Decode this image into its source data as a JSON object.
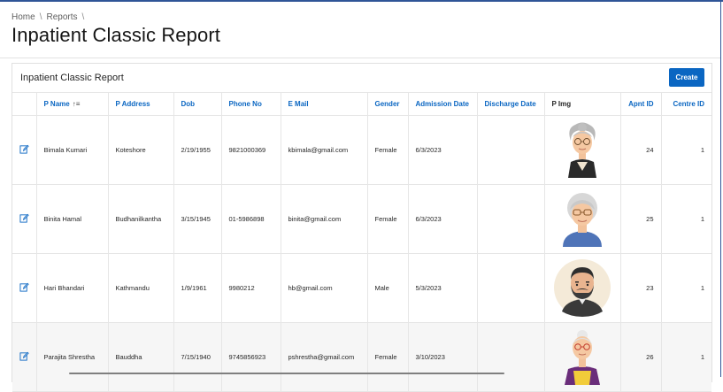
{
  "breadcrumb": {
    "items": [
      "Home",
      "Reports"
    ],
    "separator": "\\"
  },
  "page": {
    "title": "Inpatient Classic Report"
  },
  "region": {
    "title": "Inpatient Classic Report",
    "create_label": "Create"
  },
  "table": {
    "columns": [
      "P Name",
      "P Address",
      "Dob",
      "Phone No",
      "E Mail",
      "Gender",
      "Admission Date",
      "Discharge Date",
      "P Img",
      "Apnt ID",
      "Centre ID"
    ],
    "sort_indicator": "↑≡",
    "rows": [
      {
        "name": "Bimala Kumari",
        "address": "Koteshore",
        "dob": "2/19/1955",
        "phone": "9821000369",
        "email": "kbimala@gmail.com",
        "gender": "Female",
        "admission": "6/3/2023",
        "discharge": "",
        "img": "elderly-woman-avatar",
        "apnt_id": "24",
        "centre_id": "1"
      },
      {
        "name": "Binita Hamal",
        "address": "Budhanilkantha",
        "dob": "3/15/1945",
        "phone": "01-5986898",
        "email": "binita@gmail.com",
        "gender": "Female",
        "admission": "6/3/2023",
        "discharge": "",
        "img": "grandmother-avatar",
        "apnt_id": "25",
        "centre_id": "1"
      },
      {
        "name": "Hari Bhandari",
        "address": "Kathmandu",
        "dob": "1/9/1961",
        "phone": "9980212",
        "email": "hb@gmail.com",
        "gender": "Male",
        "admission": "5/3/2023",
        "discharge": "",
        "img": "bearded-man-avatar",
        "apnt_id": "23",
        "centre_id": "1"
      },
      {
        "name": "Parajita Shrestha",
        "address": "Bauddha",
        "dob": "7/15/1940",
        "phone": "9745856923",
        "email": "pshrestha@gmail.com",
        "gender": "Female",
        "admission": "3/10/2023",
        "discharge": "",
        "img": "old-woman-avatar",
        "apnt_id": "26",
        "centre_id": "1"
      }
    ]
  },
  "colors": {
    "accent": "#0a66c2",
    "frame": "#2f5597"
  }
}
